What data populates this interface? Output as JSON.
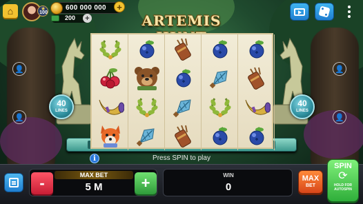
{
  "topbar": {
    "level": "100",
    "coins": "600 000 000",
    "gems": "200",
    "add_symbol": "+"
  },
  "game": {
    "title": "ARTEMIS HUNT",
    "lines_left": "40",
    "lines_right": "40",
    "lines_label": "LINES",
    "hint": "Press SPIN to play",
    "info_symbol": "i"
  },
  "reels": [
    [
      "laurel-wreath",
      "cherries",
      "hunting-horn",
      "fox"
    ],
    [
      "blueberry",
      "bear",
      "laurel-wreath",
      "arrow-tip"
    ],
    [
      "quiver",
      "blueberry",
      "arrow-tip",
      "quiver"
    ],
    [
      "blueberry",
      "arrow-tip",
      "laurel-wreath",
      "blueberry"
    ],
    [
      "blueberry",
      "quiver",
      "hunting-horn",
      "blueberry"
    ]
  ],
  "controls": {
    "minus": "-",
    "plus": "+",
    "bet_label": "MAX BET",
    "bet_value": "5 M",
    "win_label": "WIN",
    "win_value": "0",
    "maxbet_top": "MAX",
    "maxbet_bottom": "BET",
    "spin_label": "SPIN",
    "spin_sub": "HOLD FOR AUTOSPIN"
  },
  "colors": {
    "accent_gold": "#f2c230",
    "bet_minus": "#e02a40",
    "bet_plus": "#3fb048",
    "max_bet": "#f06a2a",
    "spin": "#4fd050",
    "frame_teal": "#5fbfb0"
  }
}
